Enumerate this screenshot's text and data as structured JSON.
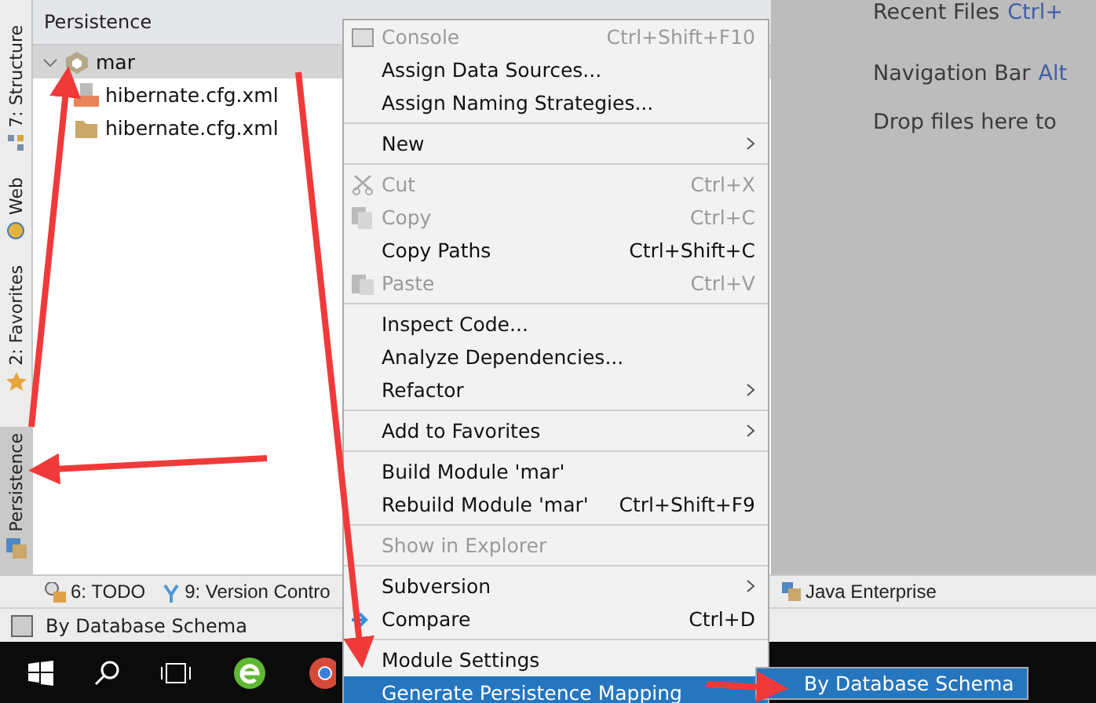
{
  "tool_strip": [
    {
      "label": "7: Structure",
      "kind": "structure",
      "selected": false
    },
    {
      "label": "Web",
      "kind": "web",
      "selected": false
    },
    {
      "label": "2: Favorites",
      "kind": "favorites",
      "selected": false
    },
    {
      "label": "Persistence",
      "kind": "persistence",
      "selected": true
    }
  ],
  "panel": {
    "title": "Persistence",
    "tree": [
      {
        "label": "mar",
        "expanded": true,
        "selected": true,
        "children": [
          {
            "label": "hibernate.cfg.xml",
            "kind": "xml"
          },
          {
            "label": "hibernate.cfg.xml",
            "kind": "folder"
          }
        ]
      }
    ]
  },
  "editor_hints": [
    {
      "text": "Recent Files",
      "shortcut": "Ctrl+"
    },
    {
      "text": "Navigation Bar",
      "shortcut": "Alt"
    },
    {
      "text": "Drop files here to"
    }
  ],
  "bottom_tools": [
    {
      "label": "6: TODO",
      "kind": "todo"
    },
    {
      "label": "9: Version Contro",
      "kind": "vcs"
    },
    {
      "label": "Java Enterprise",
      "kind": "javaee"
    }
  ],
  "status_bar": {
    "text": "By Database Schema"
  },
  "context_menu": {
    "items": [
      {
        "kind": "console",
        "label": "Console",
        "shortcut": "Ctrl+Shift+F10",
        "disabled": true,
        "selected": false
      },
      {
        "kind": "item",
        "label": "Assign Data Sources...",
        "disabled": false,
        "selected": false
      },
      {
        "kind": "item",
        "label": "Assign Naming Strategies...",
        "disabled": false,
        "selected": false
      },
      {
        "kind": "separator"
      },
      {
        "kind": "submenu",
        "label": "New",
        "disabled": false,
        "selected": false
      },
      {
        "kind": "separator"
      },
      {
        "kind": "cut",
        "label": "Cut",
        "shortcut": "Ctrl+X",
        "disabled": true,
        "selected": false
      },
      {
        "kind": "copy",
        "label": "Copy",
        "shortcut": "Ctrl+C",
        "disabled": true,
        "selected": false
      },
      {
        "kind": "item",
        "label": "Copy Paths",
        "shortcut": "Ctrl+Shift+C",
        "disabled": false,
        "selected": false
      },
      {
        "kind": "paste",
        "label": "Paste",
        "shortcut": "Ctrl+V",
        "disabled": true,
        "selected": false
      },
      {
        "kind": "separator"
      },
      {
        "kind": "item",
        "label": "Inspect Code...",
        "disabled": false,
        "selected": false
      },
      {
        "kind": "item",
        "label": "Analyze Dependencies...",
        "disabled": false,
        "selected": false
      },
      {
        "kind": "submenu",
        "label": "Refactor",
        "disabled": false,
        "selected": false
      },
      {
        "kind": "separator"
      },
      {
        "kind": "submenu",
        "label": "Add to Favorites",
        "disabled": false,
        "selected": false
      },
      {
        "kind": "separator"
      },
      {
        "kind": "item",
        "label": "Build Module 'mar'",
        "disabled": false,
        "selected": false
      },
      {
        "kind": "item",
        "label": "Rebuild Module 'mar'",
        "shortcut": "Ctrl+Shift+F9",
        "disabled": false,
        "selected": false
      },
      {
        "kind": "separator"
      },
      {
        "kind": "item",
        "label": "Show in Explorer",
        "disabled": true,
        "selected": false
      },
      {
        "kind": "separator"
      },
      {
        "kind": "submenu",
        "label": "Subversion",
        "disabled": false,
        "selected": false
      },
      {
        "kind": "compare",
        "label": "Compare",
        "shortcut": "Ctrl+D",
        "disabled": false,
        "selected": false
      },
      {
        "kind": "separator"
      },
      {
        "kind": "item",
        "label": "Module Settings",
        "disabled": false,
        "selected": false
      },
      {
        "kind": "item",
        "label": "Generate Persistence Mapping",
        "disabled": false,
        "selected": true
      }
    ]
  },
  "submenu": {
    "items": [
      {
        "label": "By Database Schema",
        "selected": true
      }
    ]
  }
}
